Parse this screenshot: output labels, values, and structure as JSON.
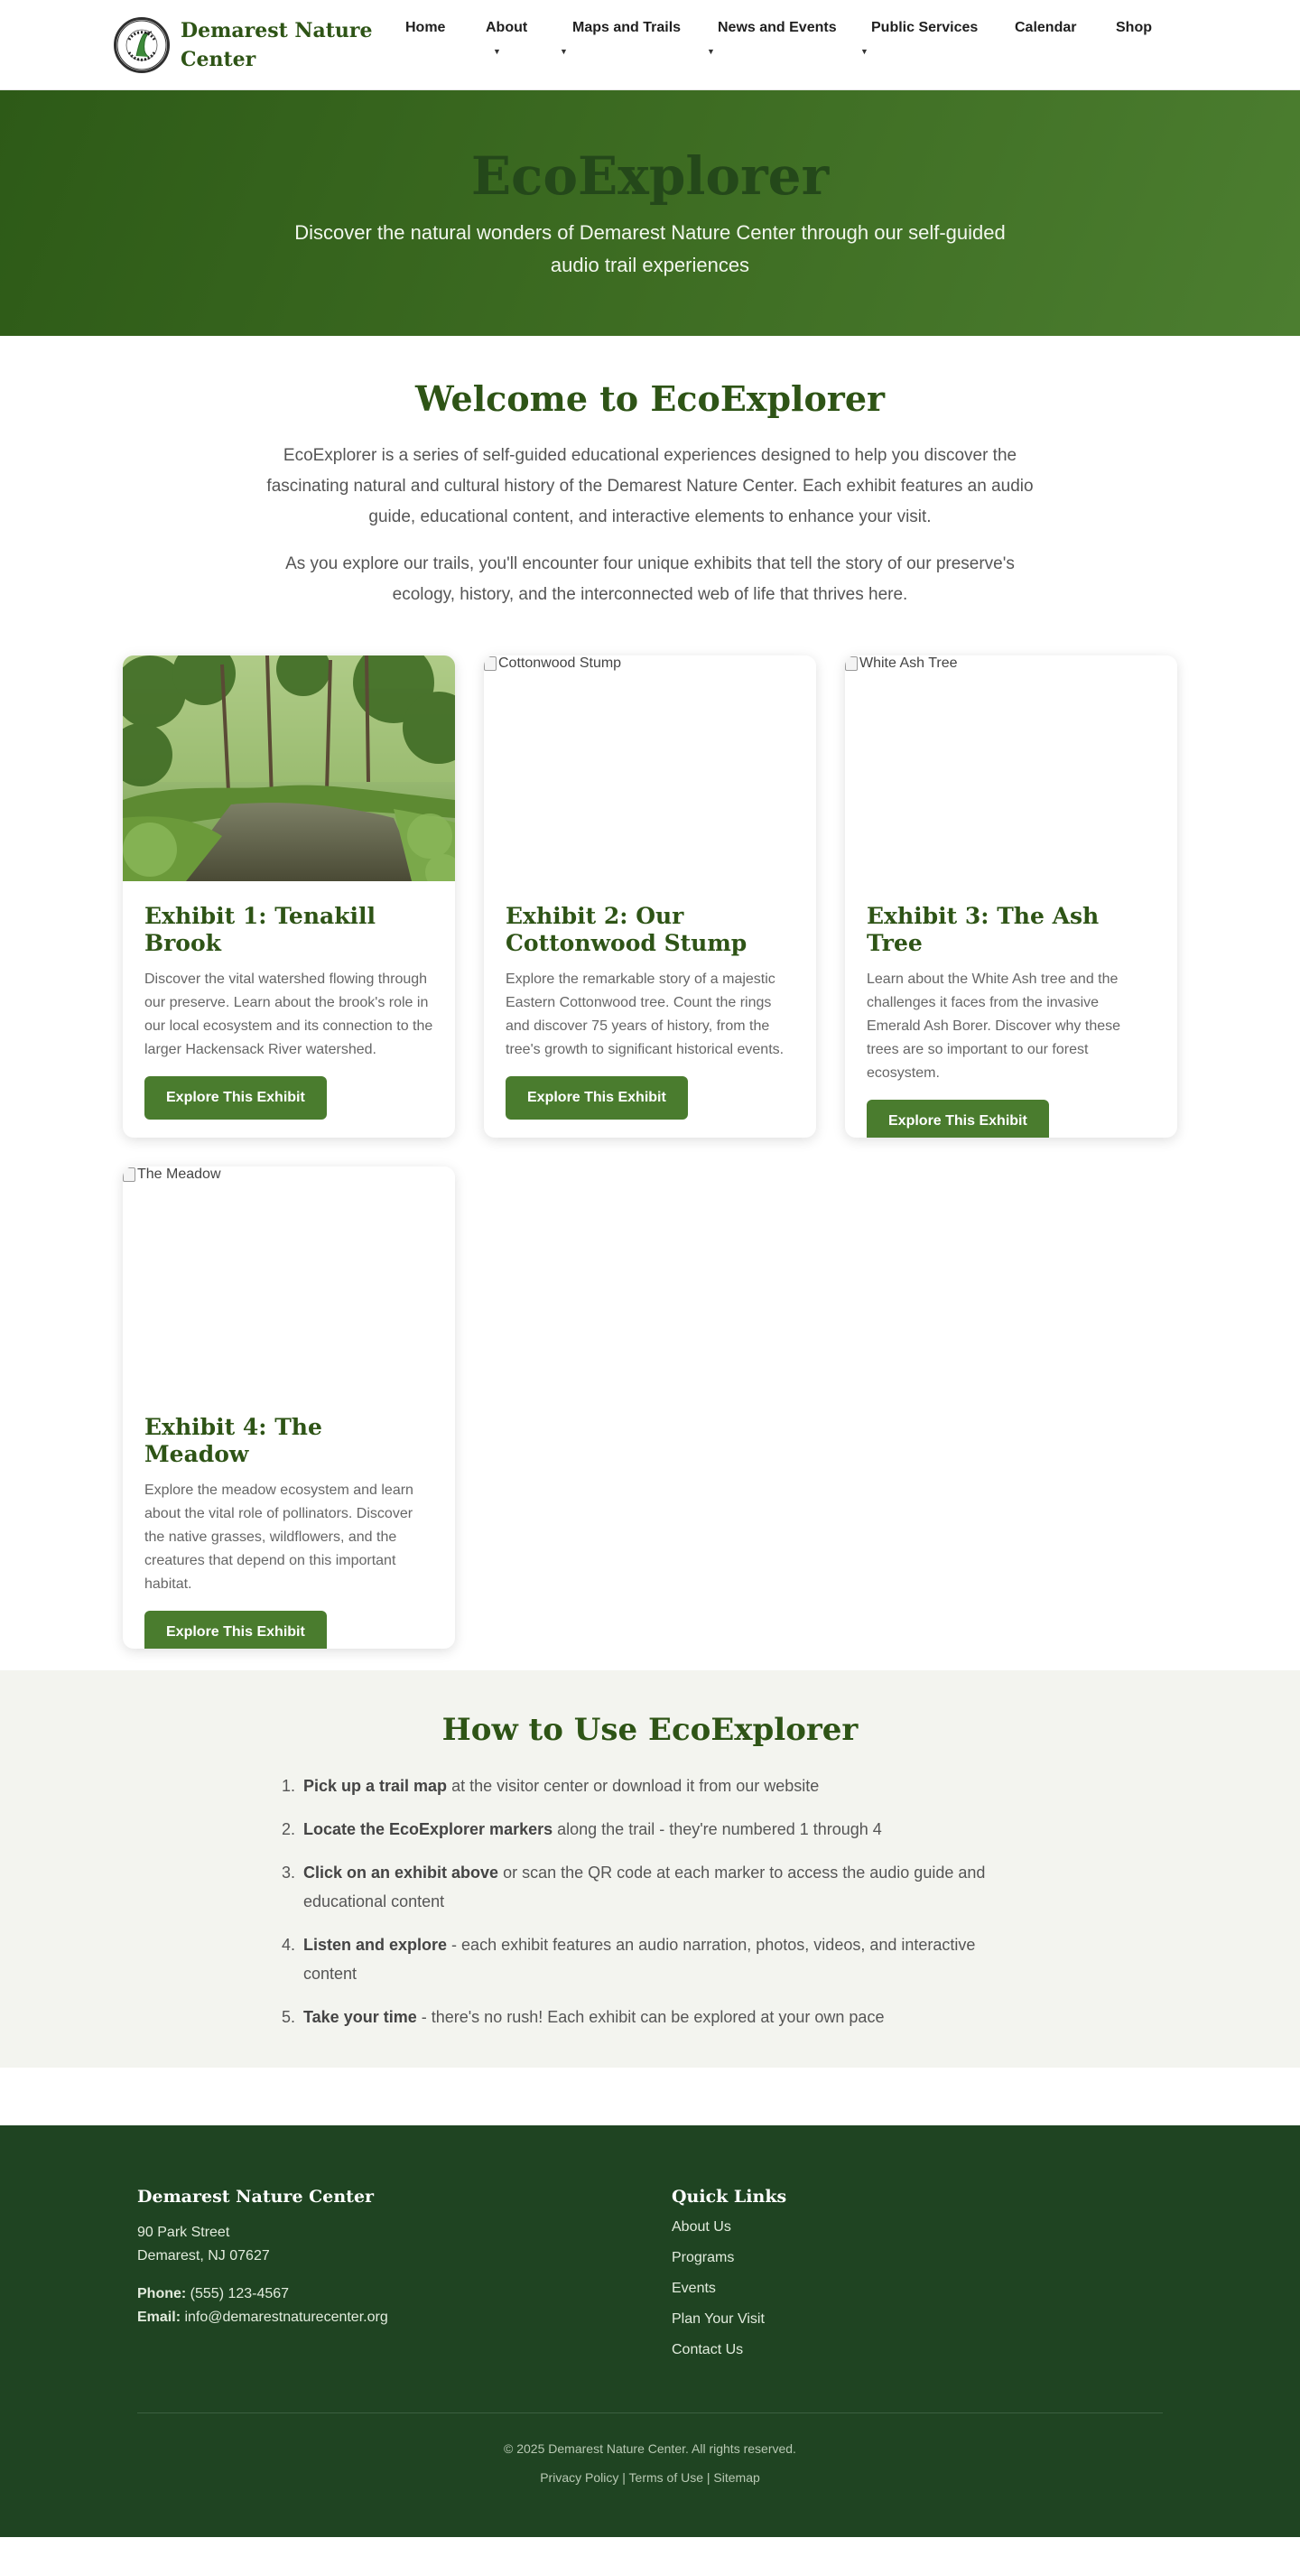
{
  "header": {
    "site_name": "Demarest Nature Center",
    "logo_text": "DEMAREST NATURE CENTER",
    "nav": [
      {
        "label": "Home",
        "has_dropdown": false
      },
      {
        "label": "About",
        "has_dropdown": true
      },
      {
        "label": "Maps and Trails",
        "has_dropdown": true
      },
      {
        "label": "News and Events",
        "has_dropdown": true
      },
      {
        "label": "Public Services",
        "has_dropdown": true
      },
      {
        "label": "Calendar",
        "has_dropdown": false
      },
      {
        "label": "Shop",
        "has_dropdown": false
      }
    ],
    "caret": "▼"
  },
  "hero": {
    "title": "EcoExplorer",
    "subtitle": "Discover the natural wonders of Demarest Nature Center through our self-guided audio trail experiences"
  },
  "intro": {
    "heading": "Welcome to EcoExplorer",
    "paragraph1": "EcoExplorer is a series of self-guided educational experiences designed to help you discover the fascinating natural and cultural history of the Demarest Nature Center. Each exhibit features an audio guide, educational content, and interactive elements to enhance your visit.",
    "paragraph2": "As you explore our trails, you'll encounter four unique exhibits that tell the story of our preserve's ecology, history, and the interconnected web of life that thrives here."
  },
  "exhibits": [
    {
      "image_alt": "Tenakill Brook",
      "image_loaded": true,
      "title": "Exhibit 1: Tenakill Brook",
      "description": "Discover the vital watershed flowing through our preserve. Learn about the brook's role in our local ecosystem and its connection to the larger Hackensack River watershed.",
      "button": "Explore This Exhibit"
    },
    {
      "image_alt": "Cottonwood Stump",
      "image_loaded": false,
      "title": "Exhibit 2: Our Cottonwood Stump",
      "description": "Explore the remarkable story of a majestic Eastern Cottonwood tree. Count the rings and discover 75 years of history, from the tree's growth to significant historical events.",
      "button": "Explore This Exhibit"
    },
    {
      "image_alt": "White Ash Tree",
      "image_loaded": false,
      "title": "Exhibit 3: The Ash Tree",
      "description": "Learn about the White Ash tree and the challenges it faces from the invasive Emerald Ash Borer. Discover why these trees are so important to our forest ecosystem.",
      "button": "Explore This Exhibit"
    },
    {
      "image_alt": "The Meadow",
      "image_loaded": false,
      "title": "Exhibit 4: The Meadow",
      "description": "Explore the meadow ecosystem and learn about the vital role of pollinators. Discover the native grasses, wildflowers, and the creatures that depend on this important habitat.",
      "button": "Explore This Exhibit"
    }
  ],
  "howto": {
    "heading": "How to Use EcoExplorer",
    "steps": [
      {
        "strong": "Pick up a trail map",
        "rest": " at the visitor center or download it from our website"
      },
      {
        "strong": "Locate the EcoExplorer markers",
        "rest": " along the trail - they're numbered 1 through 4"
      },
      {
        "strong": "Click on an exhibit above",
        "rest": " or scan the QR code at each marker to access the audio guide and educational content"
      },
      {
        "strong": "Listen and explore",
        "rest": " - each exhibit features an audio narration, photos, videos, and interactive content"
      },
      {
        "strong": "Take your time",
        "rest": " - there's no rush! Each exhibit can be explored at your own pace"
      }
    ]
  },
  "footer": {
    "org_heading": "Demarest Nature Center",
    "address_line1": "90 Park Street",
    "address_line2": "Demarest, NJ 07627",
    "phone_label": "Phone:",
    "phone": " (555) 123-4567",
    "email_label": "Email:",
    "email": " info@demarestnaturecenter.org",
    "links_heading": "Quick Links",
    "links": [
      "About Us",
      "Programs",
      "Events",
      "Plan Your Visit",
      "Contact Us"
    ],
    "copyright": "© 2025 Demarest Nature Center. All rights reserved.",
    "legal_links": [
      "Privacy Policy",
      "Terms of Use",
      "Sitemap"
    ],
    "separator": " | "
  },
  "colors": {
    "brand_green": "#2e5416",
    "button_green": "#4a7c2e",
    "footer_green": "#1f4422",
    "howto_bg": "#f3f4ef"
  }
}
